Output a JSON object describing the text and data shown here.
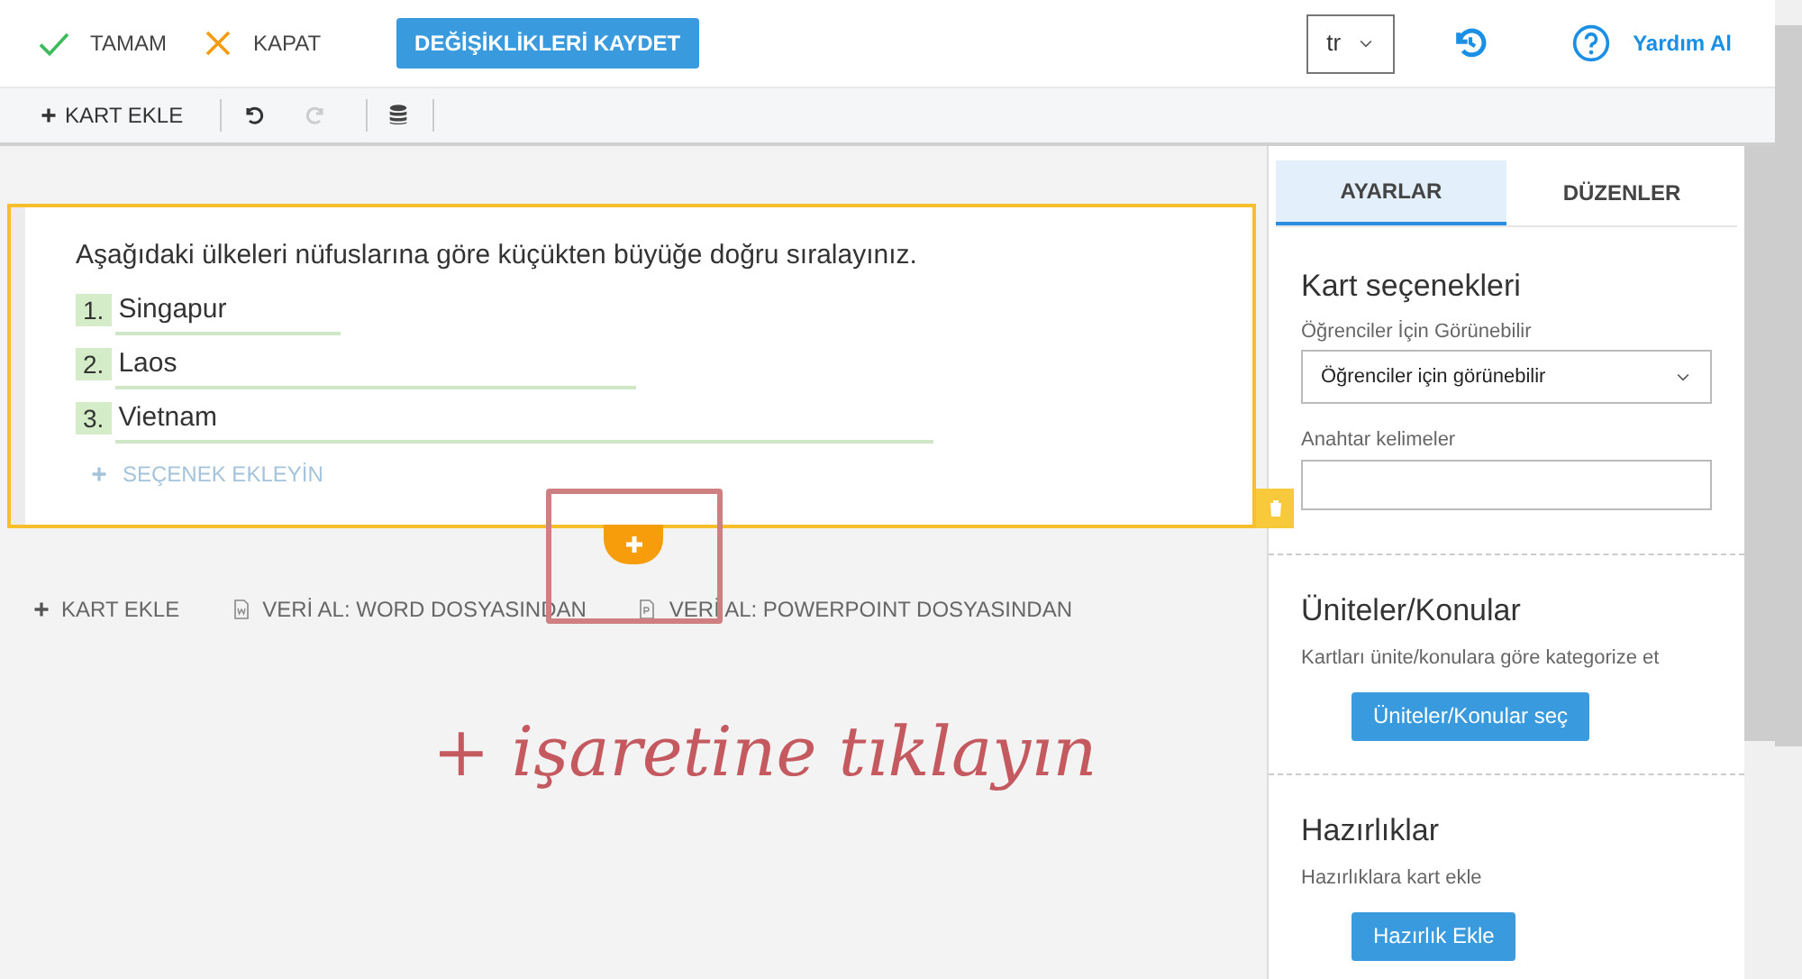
{
  "top_bar": {
    "actions": [
      {
        "kind": "confirm",
        "label": "TAMAM"
      },
      {
        "kind": "close",
        "label": "KAPAT"
      },
      {
        "kind": "primary",
        "label": "DEĞİŞİKLİKLERİ KAYDET"
      }
    ],
    "language_select": {
      "value": "tr"
    },
    "help": "Yardım Al"
  },
  "toolbar": {
    "add_card": "KART EKLE",
    "undo": {
      "disabled": false
    },
    "redo": {
      "disabled": true
    }
  },
  "card": {
    "question": "Aşağıdaki ülkeleri nüfuslarına göre küçükten büyüğe doğru sıralayınız.",
    "options": [
      {
        "number": "1.",
        "text": "Singapur"
      },
      {
        "number": "2.",
        "text": "Laos"
      },
      {
        "number": "3.",
        "text": "Vietnam"
      }
    ],
    "add_option": "SEÇENEK EKLEYİN"
  },
  "bottom_links": [
    {
      "kind": "add",
      "label": "KART EKLE"
    },
    {
      "kind": "word",
      "label": "VERİ AL: WORD DOSYASINDAN"
    },
    {
      "kind": "powerpoint",
      "label": "VERİ AL: POWERPOINT DOSYASINDAN"
    }
  ],
  "annotation": "+ işaretine tıklayın",
  "panel": {
    "tabs": [
      {
        "label": "AYARLAR",
        "selected": true
      },
      {
        "label": "DÜZENLER",
        "selected": false
      }
    ],
    "card_options": {
      "title": "Kart seçenekleri",
      "visibility_label": "Öğrenciler İçin Görünebilir",
      "visibility_value": "Öğrenciler için görünebilir",
      "keywords_label": "Anahtar kelimeler"
    },
    "units": {
      "title": "Üniteler/Konular",
      "description": "Kartları ünite/konulara göre kategorize et",
      "button": "Üniteler/Konular seç"
    },
    "preparations": {
      "title": "Hazırlıklar",
      "description": "Hazırlıklara kart ekle",
      "button": "Hazırlık Ekle"
    }
  }
}
